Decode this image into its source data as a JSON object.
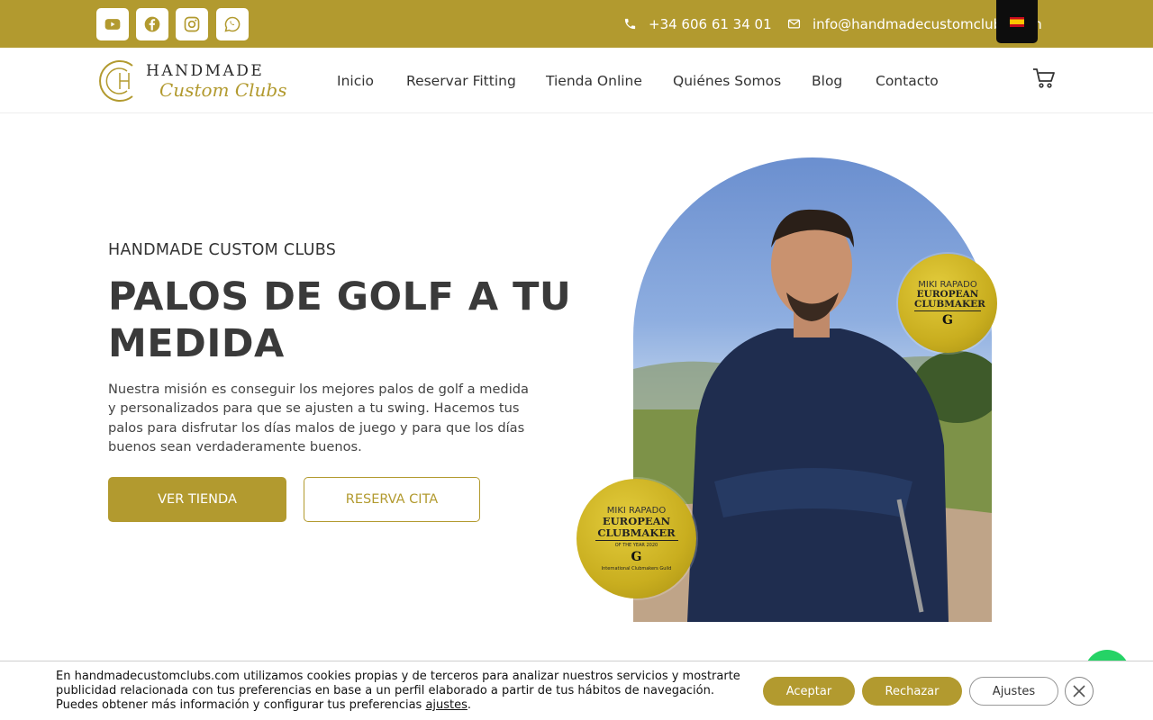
{
  "topbar": {
    "phone": "+34 606 61 34 01",
    "email": "info@handmadecustomclubs.com",
    "language": "es-flag"
  },
  "logo": {
    "line1": "HANDMADE",
    "line2": "Custom Clubs"
  },
  "nav": {
    "items": [
      "Inicio",
      "Reservar Fitting",
      "Tienda Online",
      "Quiénes Somos",
      "Blog",
      "Contacto"
    ]
  },
  "hero": {
    "kicker": "HANDMADE CUSTOM CLUBS",
    "headline": "PALOS DE GOLF A TU MEDIDA",
    "description": "Nuestra misión es conseguir los mejores palos de golf a medida y personalizados para que se ajusten a tu swing. Hacemos tus palos para disfrutar los días malos de juego y para que los días buenos sean verdaderamente buenos.",
    "primary_button": "VER TIENDA",
    "secondary_button": "RESERVA CITA"
  },
  "badge": {
    "name": "MIKI RAPADO",
    "title": "EUROPEAN CLUBMAKER",
    "year": "OF THE YEAR 2020",
    "guild": "International Clubmakers Guild"
  },
  "cookie": {
    "text": "En handmadecustomclubs.com utilizamos cookies propias y de terceros para analizar nuestros servicios y mostrarte publicidad relacionada con tus preferencias en base a un perfil elaborado a partir de tus hábitos de navegación. Puedes obtener más información y configurar tus preferencias ",
    "link": "ajustes",
    "accept": "Aceptar",
    "reject": "Rechazar",
    "settings": "Ajustes"
  },
  "colors": {
    "brand_gold": "#b29a2f",
    "dark": "#3a3a3a"
  }
}
